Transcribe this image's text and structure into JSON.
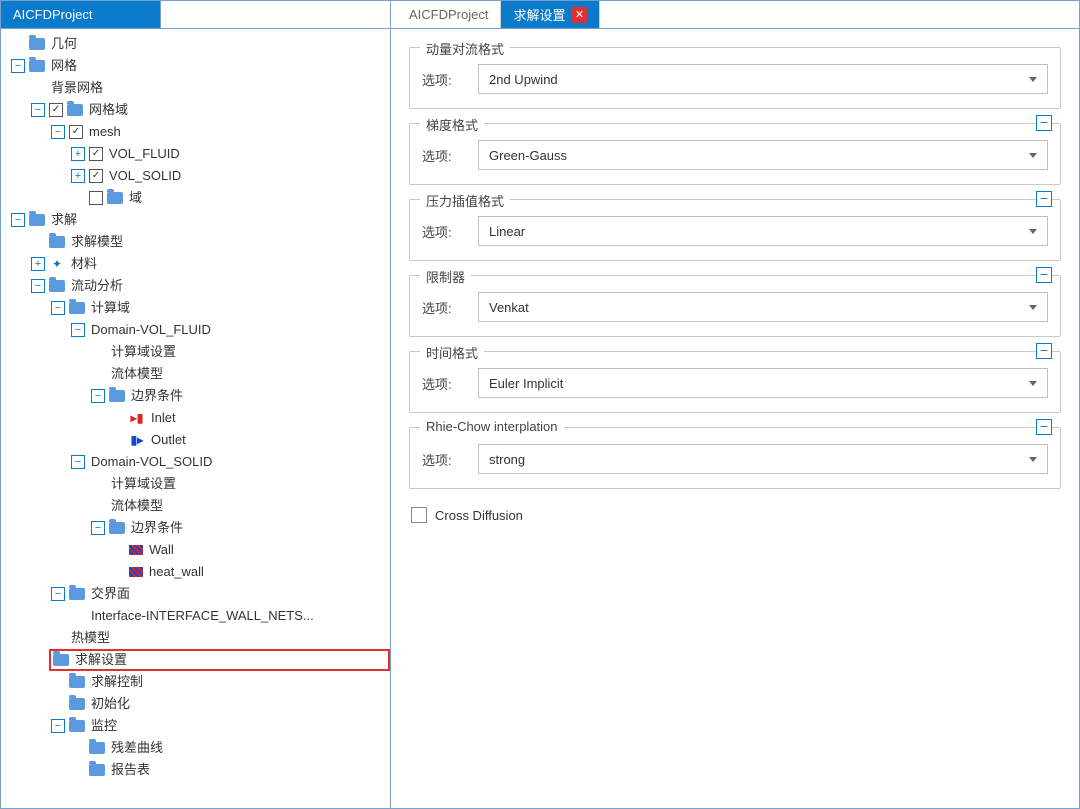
{
  "left_panel": {
    "tab_label": "AICFDProject",
    "tree": {
      "geometry": "几何",
      "mesh": "网格",
      "background_mesh": "背景网格",
      "mesh_domain": "网格域",
      "mesh_item": "mesh",
      "vol_fluid": "VOL_FLUID",
      "vol_solid": "VOL_SOLID",
      "domain_cn": "域",
      "solve": "求解",
      "solve_model": "求解模型",
      "material": "材料",
      "flow_analysis": "流动分析",
      "compute_domain": "计算域",
      "domain_vol_fluid": "Domain-VOL_FLUID",
      "domain_vol_solid": "Domain-VOL_SOLID",
      "compute_domain_settings": "计算域设置",
      "fluid_model": "流体模型",
      "boundary_conditions": "边界条件",
      "inlet": "Inlet",
      "outlet": "Outlet",
      "wall": "Wall",
      "heat_wall": "heat_wall",
      "interface": "交界面",
      "interface_item": "Interface-INTERFACE_WALL_NETS...",
      "heat_model": "热模型",
      "solve_settings": "求解设置",
      "solve_control": "求解控制",
      "initialize": "初始化",
      "monitor": "监控",
      "residual_curve": "残差曲线",
      "report_table": "报告表"
    }
  },
  "right_panel": {
    "tab1_label": "AICFDProject",
    "tab2_label": "求解设置",
    "option_label": "选项:",
    "groups": [
      {
        "title": "动量对流格式",
        "value": "2nd Upwind",
        "collapsible": false
      },
      {
        "title": "梯度格式",
        "value": "Green-Gauss",
        "collapsible": true
      },
      {
        "title": "压力插值格式",
        "value": "Linear",
        "collapsible": true
      },
      {
        "title": "限制器",
        "value": "Venkat",
        "collapsible": true
      },
      {
        "title": "时间格式",
        "value": "Euler Implicit",
        "collapsible": true
      },
      {
        "title": "Rhie-Chow interplation",
        "value": "strong",
        "collapsible": true
      }
    ],
    "cross_diffusion_label": "Cross Diffusion",
    "cross_diffusion_checked": false
  }
}
